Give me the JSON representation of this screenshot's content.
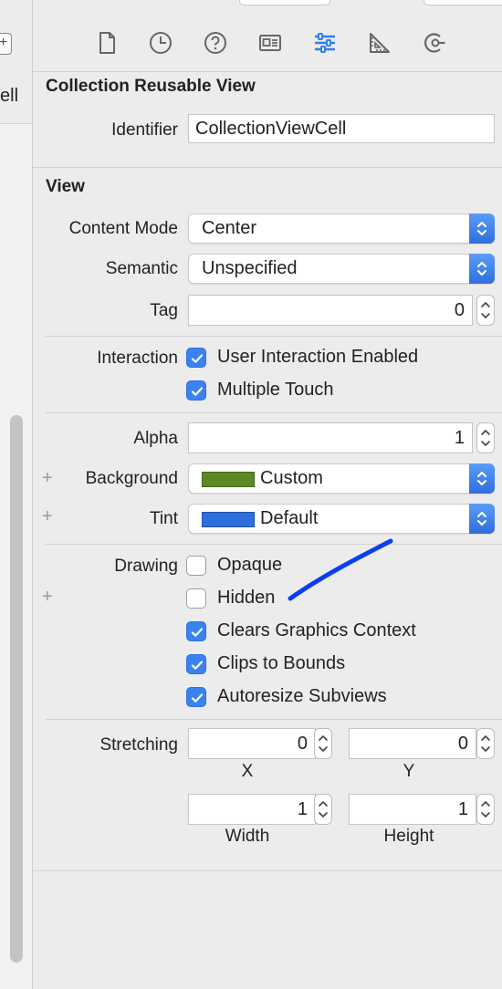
{
  "left_panel": {
    "partial_label": "ell",
    "plus_glyph": "+"
  },
  "toolbar": {
    "icons": [
      "file-icon",
      "history-icon",
      "help-icon",
      "identity-icon",
      "attributes-icon",
      "size-ruler-icon",
      "connections-icon"
    ],
    "active_icon": "attributes-icon",
    "accent_color": "#2f7ff0"
  },
  "reusable_view": {
    "title": "Collection Reusable View",
    "identifier_label": "Identifier",
    "identifier_value": "CollectionViewCell"
  },
  "view": {
    "title": "View",
    "content_mode": {
      "label": "Content Mode",
      "value": "Center"
    },
    "semantic": {
      "label": "Semantic",
      "value": "Unspecified"
    },
    "tag": {
      "label": "Tag",
      "value": "0"
    },
    "interaction": {
      "label": "Interaction",
      "options": [
        {
          "label": "User Interaction Enabled",
          "checked": true
        },
        {
          "label": "Multiple Touch",
          "checked": true
        }
      ]
    },
    "alpha": {
      "label": "Alpha",
      "value": "1"
    },
    "background": {
      "label": "Background",
      "value": "Custom",
      "color": "#5b8a25"
    },
    "tint": {
      "label": "Tint",
      "value": "Default",
      "color": "#2f6fdc"
    },
    "drawing": {
      "label": "Drawing",
      "options": [
        {
          "label": "Opaque",
          "checked": false
        },
        {
          "label": "Hidden",
          "checked": false
        },
        {
          "label": "Clears Graphics Context",
          "checked": true
        },
        {
          "label": "Clips to Bounds",
          "checked": true
        },
        {
          "label": "Autoresize Subviews",
          "checked": true
        }
      ]
    },
    "stretching": {
      "label": "Stretching",
      "x": {
        "value": "0",
        "caption": "X"
      },
      "y": {
        "value": "0",
        "caption": "Y"
      },
      "width": {
        "value": "1",
        "caption": "Width"
      },
      "height": {
        "value": "1",
        "caption": "Height"
      }
    }
  },
  "colors": {
    "checkbox_on": "#3b82f1",
    "annotation_stroke": "#0a3ff0"
  }
}
